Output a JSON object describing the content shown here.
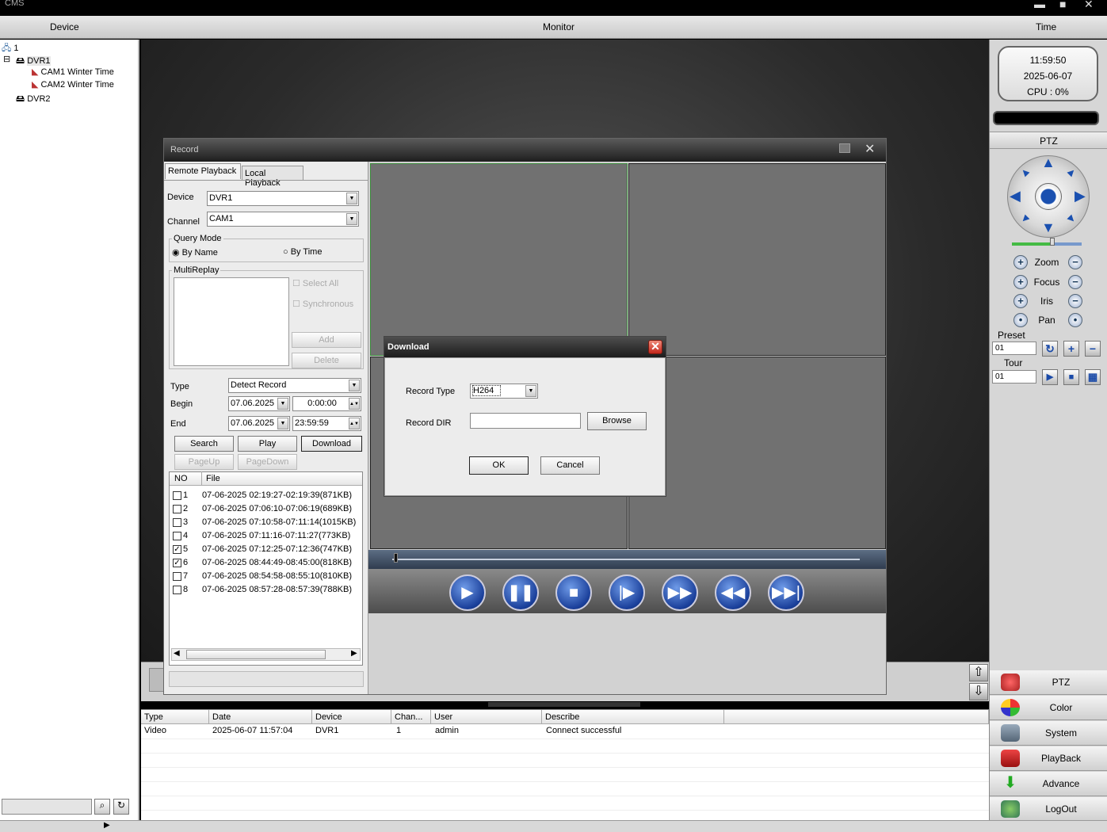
{
  "app": {
    "title": "CMS"
  },
  "header": {
    "device": "Device",
    "monitor": "Monitor",
    "time": "Time"
  },
  "tree": {
    "root": "1",
    "dvr1": "DVR1",
    "cam1": "CAM1 Winter Time",
    "cam2": "CAM2 Winter Time",
    "dvr2": "DVR2"
  },
  "clock": {
    "time": "11:59:50",
    "date": "2025-06-07",
    "cpu": "CPU : 0%"
  },
  "ptz": {
    "header": "PTZ",
    "zoom": "Zoom",
    "focus": "Focus",
    "iris": "Iris",
    "pan": "Pan",
    "preset_label": "Preset",
    "preset_value": "01",
    "tour_label": "Tour",
    "tour_value": "01"
  },
  "menu": [
    "PTZ",
    "Color",
    "System",
    "PlayBack",
    "Advance",
    "LogOut"
  ],
  "record": {
    "title": "Record",
    "tab_remote": "Remote Playback",
    "tab_local": "Local Playback",
    "device_label": "Device",
    "device_value": "DVR1",
    "channel_label": "Channel",
    "channel_value": "CAM1",
    "query_mode": "Query Mode",
    "by_name": "By Name",
    "by_time": "By Time",
    "multireplay": "MultiReplay",
    "select_all": "Select All",
    "synchronous": "Synchronous",
    "add": "Add",
    "delete": "Delete",
    "type_label": "Type",
    "type_value": "Detect Record",
    "begin_label": "Begin",
    "begin_date": "07.06.2025",
    "begin_time": "0:00:00",
    "end_label": "End",
    "end_date": "07.06.2025",
    "end_time": "23:59:59",
    "search": "Search",
    "play": "Play",
    "download": "Download",
    "pageup": "PageUp",
    "pagedown": "PageDown",
    "col_no": "NO",
    "col_file": "File",
    "files": [
      {
        "no": "1",
        "name": "07-06-2025 02:19:27-02:19:39(871KB)",
        "checked": false
      },
      {
        "no": "2",
        "name": "07-06-2025 07:06:10-07:06:19(689KB)",
        "checked": false
      },
      {
        "no": "3",
        "name": "07-06-2025 07:10:58-07:11:14(1015KB)",
        "checked": false
      },
      {
        "no": "4",
        "name": "07-06-2025 07:11:16-07:11:27(773KB)",
        "checked": false
      },
      {
        "no": "5",
        "name": "07-06-2025 07:12:25-07:12:36(747KB)",
        "checked": true
      },
      {
        "no": "6",
        "name": "07-06-2025 08:44:49-08:45:00(818KB)",
        "checked": true
      },
      {
        "no": "7",
        "name": "07-06-2025 08:54:58-08:55:10(810KB)",
        "checked": false
      },
      {
        "no": "8",
        "name": "07-06-2025 08:57:28-08:57:39(788KB)",
        "checked": false
      }
    ]
  },
  "download": {
    "title": "Download",
    "record_type_label": "Record Type",
    "record_type_value": "H264",
    "record_dir_label": "Record DIR",
    "record_dir_value": "",
    "browse": "Browse",
    "ok": "OK",
    "cancel": "Cancel"
  },
  "log": {
    "columns": [
      "Type",
      "Date",
      "Device",
      "Chan...",
      "User",
      "Describe"
    ],
    "rows": [
      [
        "Video",
        "2025-06-07 11:57:04",
        "DVR1",
        "1",
        "admin",
        "Connect successful"
      ]
    ]
  }
}
